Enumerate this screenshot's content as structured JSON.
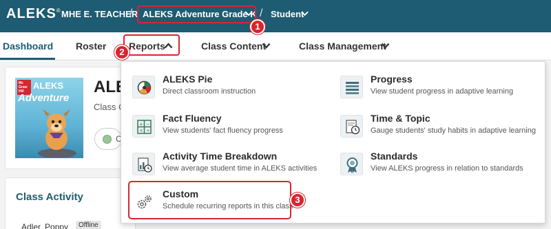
{
  "topbar": {
    "logo": "ALEKS",
    "logo_mark": "®",
    "teacher": "MHE E. TEACHER",
    "course": "ALEKS Adventure Grade K",
    "role": "Student",
    "separator": "/"
  },
  "nav": {
    "dashboard": "Dashboard",
    "roster": "Roster",
    "reports": "Reports",
    "class_content": "Class Content",
    "class_management": "Class Management"
  },
  "background": {
    "cover_brand": "Mc Graw Hill",
    "cover_line1": "ALEKS",
    "cover_line2": "Adventure",
    "class_title_partial": "ALE",
    "class_sub_partial": "Class C",
    "status_partial": "C",
    "class_activity": "Class Activity",
    "student_name": "Adler, Poppy",
    "student_status": "Offline"
  },
  "reports_menu": [
    {
      "title": "ALEKS Pie",
      "desc": "Direct classroom instruction",
      "icon": "pie-chart-icon"
    },
    {
      "title": "Progress",
      "desc": "View student progress in adaptive learning",
      "icon": "progress-list-icon"
    },
    {
      "title": "Fact Fluency",
      "desc": "View students' fact fluency progress",
      "icon": "math-operations-icon"
    },
    {
      "title": "Time & Topic",
      "desc": "Gauge students' study habits in adaptive learning",
      "icon": "clock-report-icon"
    },
    {
      "title": "Activity Time Breakdown",
      "desc": "View average student time in ALEKS activities",
      "icon": "time-breakdown-icon"
    },
    {
      "title": "Standards",
      "desc": "View ALEKS progress in relation to standards",
      "icon": "award-ribbon-icon"
    },
    {
      "title": "Custom",
      "desc": "Schedule recurring reports in this class",
      "icon": "gears-icon"
    }
  ],
  "callouts": [
    "1",
    "2",
    "3"
  ],
  "colors": {
    "brand": "#1d5c72",
    "highlight": "#d6262f"
  }
}
